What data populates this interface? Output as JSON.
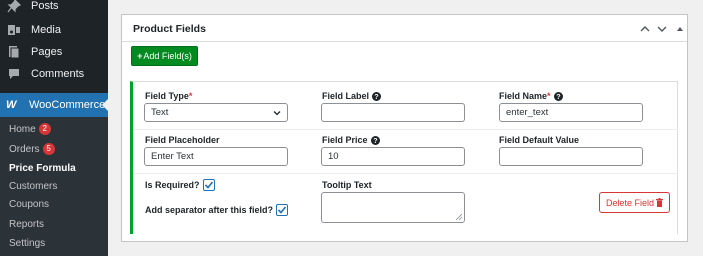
{
  "sidebar": {
    "items": [
      {
        "label": "Posts",
        "icon": "pin-icon"
      },
      {
        "label": "Media",
        "icon": "media-icon"
      },
      {
        "label": "Pages",
        "icon": "pages-icon"
      },
      {
        "label": "Comments",
        "icon": "comment-icon"
      }
    ],
    "woocommerce": {
      "label": "WooCommerce",
      "icon": "woocommerce-icon",
      "icon_glyph": "W"
    },
    "submenu": [
      {
        "label": "Home",
        "badge": "2"
      },
      {
        "label": "Orders",
        "badge": "5"
      },
      {
        "label": "Price Formula",
        "current": true
      },
      {
        "label": "Customers"
      },
      {
        "label": "Coupons"
      },
      {
        "label": "Reports"
      },
      {
        "label": "Settings"
      }
    ]
  },
  "panel": {
    "title": "Product Fields",
    "add_button": {
      "plus": "+",
      "label": "Add Field(s)"
    },
    "field": {
      "field_type": {
        "label": "Field Type",
        "required_mark": "*",
        "value": "Text"
      },
      "field_label": {
        "label": "Field Label",
        "value": ""
      },
      "field_name": {
        "label": "Field Name",
        "required_mark": "*",
        "value": "enter_text"
      },
      "field_placeholder": {
        "label": "Field Placeholder",
        "value": "Enter Text"
      },
      "field_price": {
        "label": "Field Price",
        "value": "10"
      },
      "field_default": {
        "label": "Field Default Value",
        "value": ""
      },
      "is_required": {
        "label": "Is Required?",
        "checked": true
      },
      "separator": {
        "label": "Add separator after this field?",
        "checked": true
      },
      "tooltip": {
        "label": "Tooltip Text",
        "value": ""
      },
      "delete_button": {
        "label": "Delete Field"
      }
    }
  },
  "colors": {
    "sidebar_bg": "#1d2327",
    "submenu_bg": "#2c3338",
    "active_blue": "#2271b1",
    "add_green": "#008a20",
    "field_border_green": "#00a32a",
    "delete_red": "#d63638"
  }
}
